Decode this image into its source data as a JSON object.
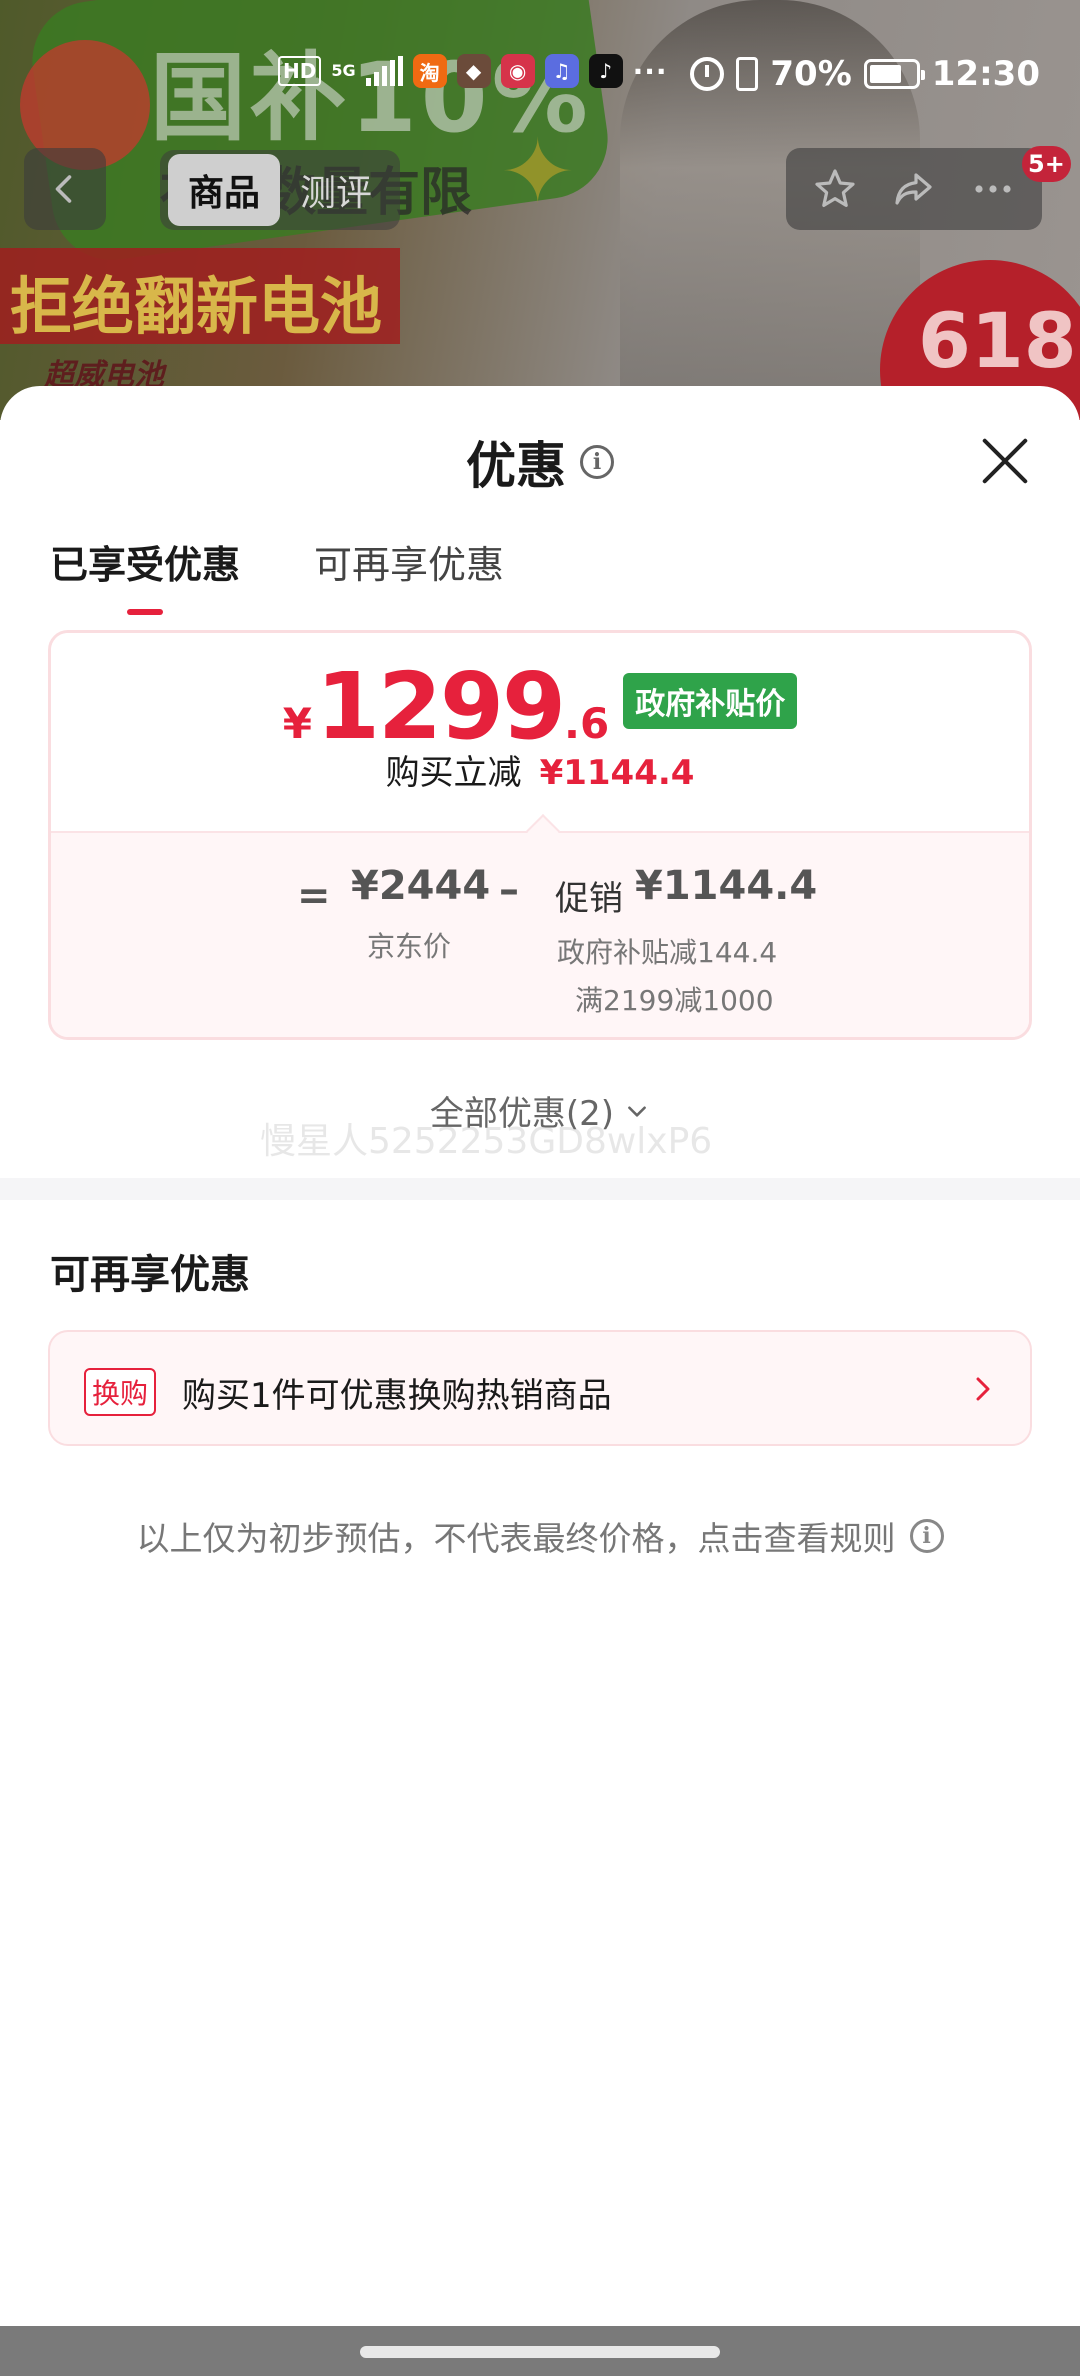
{
  "status_bar": {
    "hd": "HD",
    "signal": "5G",
    "more": "···",
    "battery": "70%",
    "time": "12:30",
    "app_icons": [
      "taobao-icon",
      "game-icon",
      "app-icon",
      "music-icon",
      "tiktok-icon"
    ]
  },
  "product_nav": {
    "tabs": [
      "商品",
      "测评"
    ],
    "badge": "5+"
  },
  "background_banner": {
    "big": "国补10%",
    "sub": "补贴数量有限",
    "red": "拒绝翻新电池",
    "brand": "超威电池",
    "sale": "618"
  },
  "sheet": {
    "title": "优惠",
    "tabs": [
      "已享受优惠",
      "可再享优惠"
    ],
    "price": {
      "yen": "¥",
      "integer": "1299",
      "decimal": ".6",
      "tag": "政府补贴价",
      "reduce_label": "购买立减",
      "reduce_value": "¥1144.4"
    },
    "breakdown": {
      "equals": "=",
      "jd_price": "¥2444",
      "jd_label": "京东价",
      "minus": "–",
      "promo_label": "促销",
      "promo_value": "¥1144.4",
      "promo_detail_1": "政府补贴减144.4",
      "promo_detail_2": "满2199减1000"
    },
    "all_promos": "全部优惠(2)",
    "watermark": "慢星人5252253GD8wlxP6",
    "more_section_title": "可再享优惠",
    "offer": {
      "tag": "换购",
      "text": "购买1件可优惠换购热销商品"
    },
    "disclaimer": "以上仅为初步预估，不代表最终价格，点击查看规则"
  },
  "colors": {
    "accent": "#e6213c",
    "tag_green": "#2fa34a",
    "card_border": "#fadde0"
  }
}
